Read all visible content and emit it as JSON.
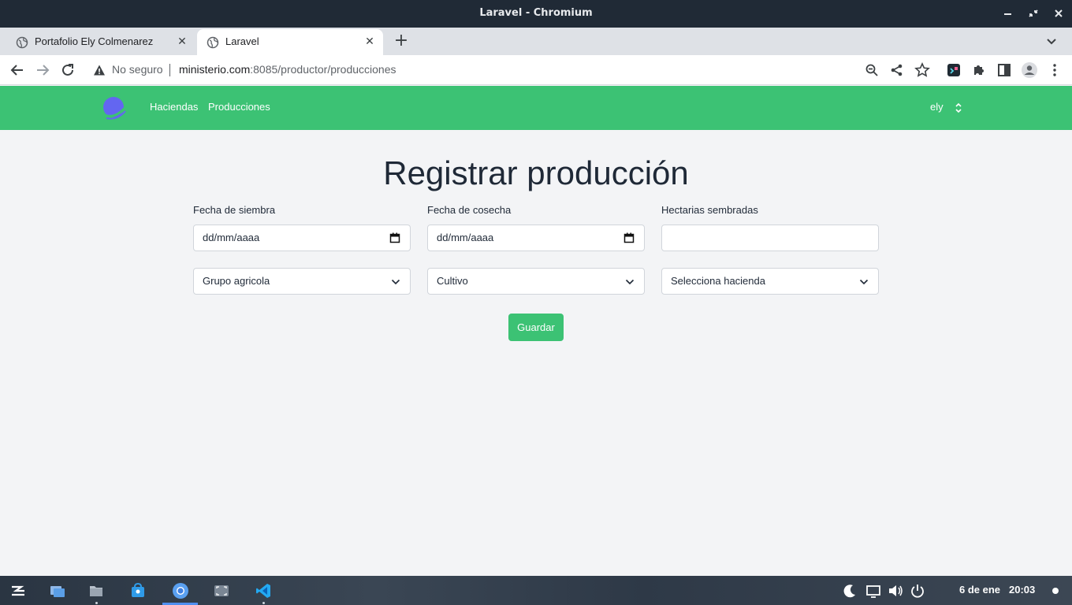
{
  "window": {
    "title": "Laravel - Chromium"
  },
  "tabs": [
    {
      "label": "Portafolio Ely Colmenarez"
    },
    {
      "label": "Laravel"
    }
  ],
  "address_bar": {
    "security_text": "No seguro",
    "host": "ministerio.com",
    "rest": ":8085/productor/producciones"
  },
  "navbar": {
    "links": [
      "Haciendas",
      "Producciones"
    ],
    "user": "ely"
  },
  "form": {
    "title": "Registrar producción",
    "fields": {
      "fecha_siembra": {
        "label": "Fecha de siembra",
        "value": "dd/mm/aaaa"
      },
      "fecha_cosecha": {
        "label": "Fecha de cosecha",
        "value": "dd/mm/aaaa"
      },
      "hectareas": {
        "label": "Hectarias sembradas",
        "value": ""
      }
    },
    "selects": {
      "grupo": "Grupo agricola",
      "cultivo": "Cultivo",
      "hacienda": "Selecciona hacienda"
    },
    "submit_label": "Guardar"
  },
  "taskbar": {
    "date": "6 de ene",
    "time": "20:03"
  },
  "colors": {
    "navbar": "#3cc274",
    "button": "#3cc274",
    "titlebar": "#202a36",
    "background": "#f3f4f6"
  }
}
